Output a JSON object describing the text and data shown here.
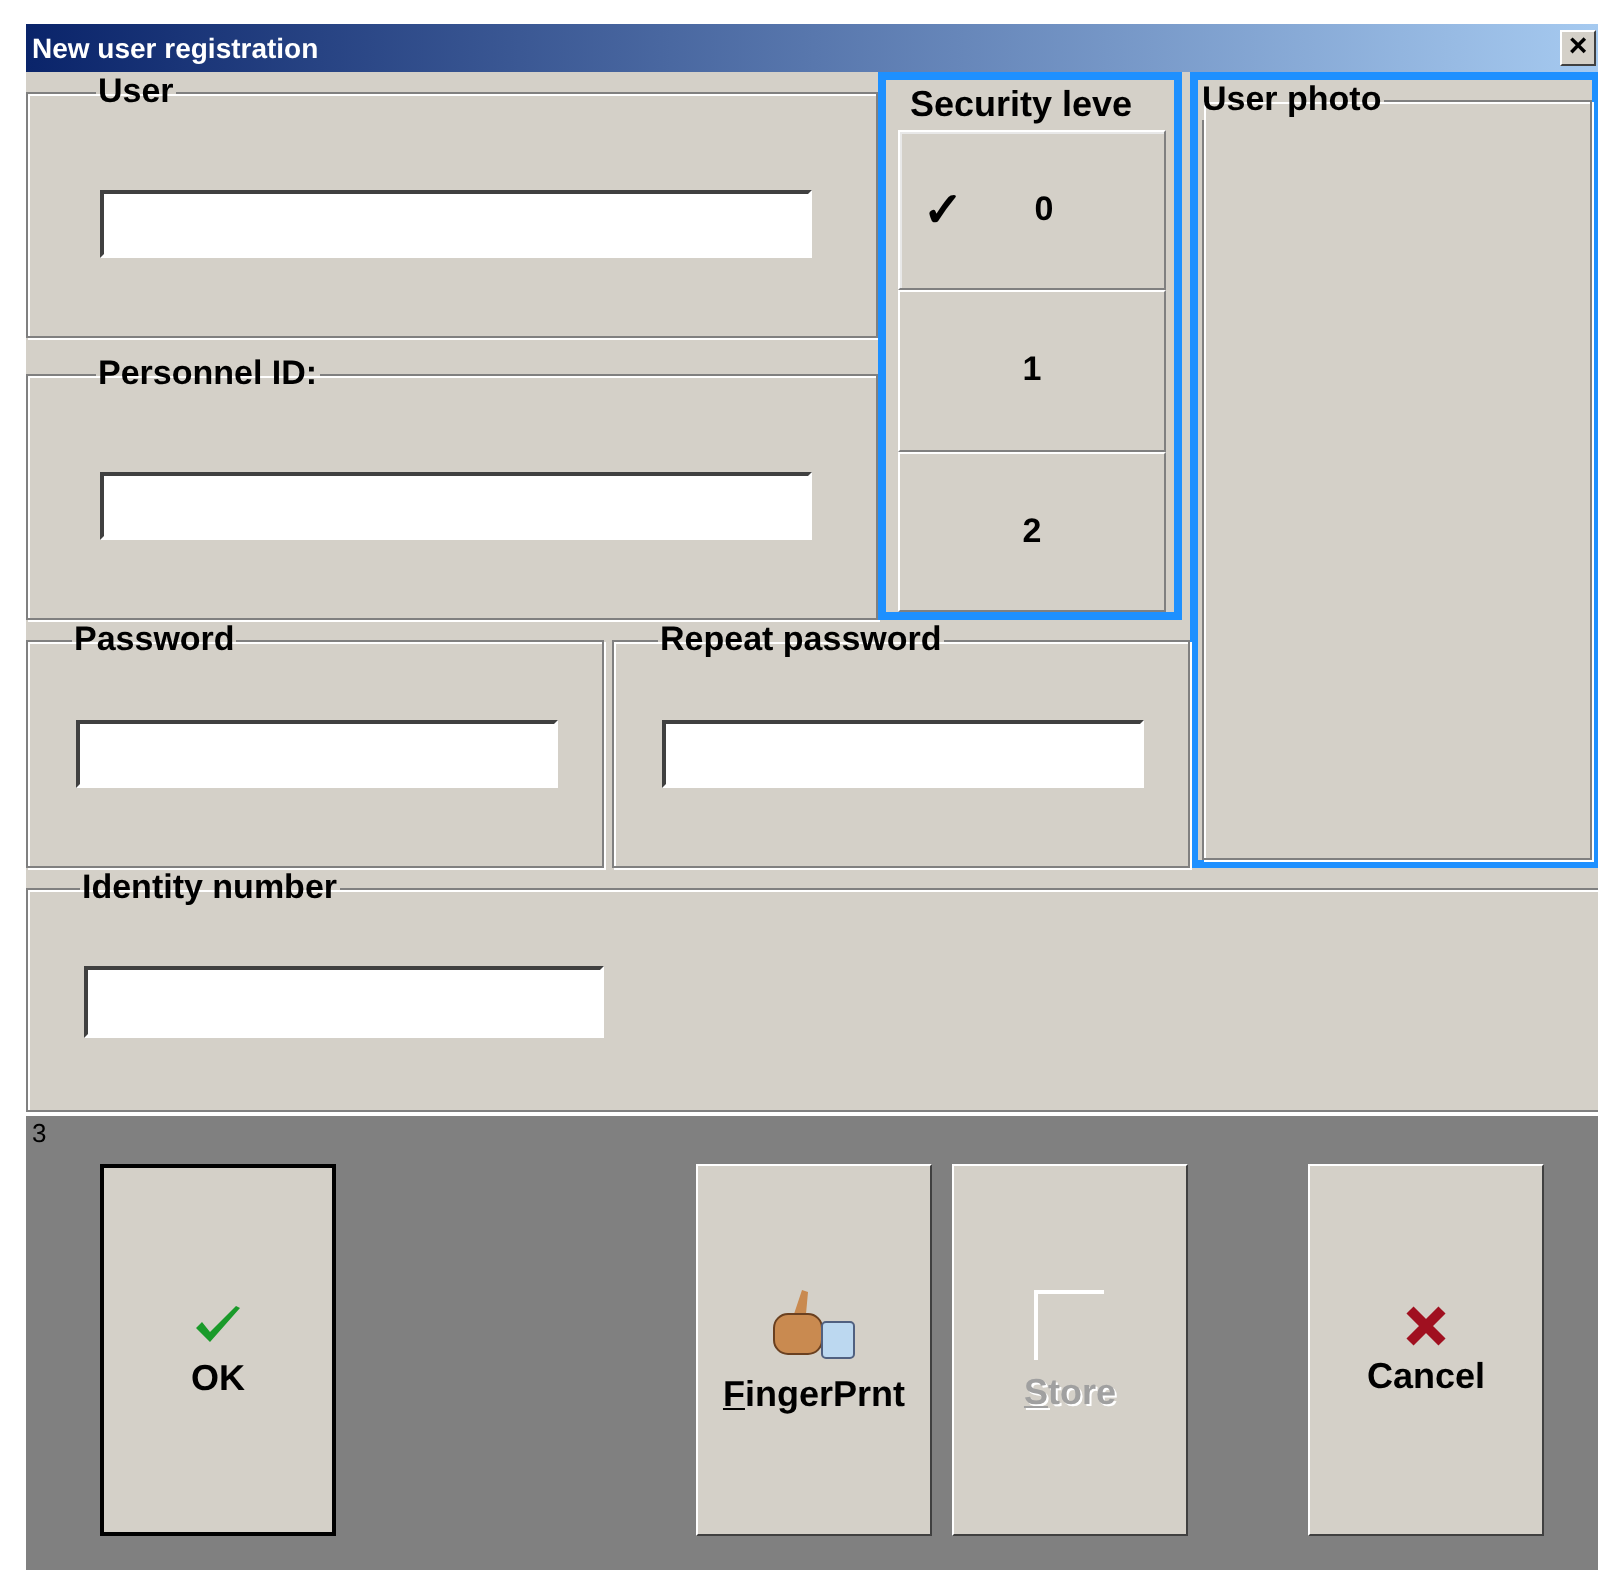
{
  "window": {
    "title": "New user registration",
    "close": "×"
  },
  "user": {
    "label": "User"
  },
  "personnel_id": {
    "label": "Personnel ID:"
  },
  "security_level": {
    "label": "Security leve",
    "mark": "✓",
    "levels": [
      {
        "label": "0",
        "selected": true
      },
      {
        "label": "1",
        "selected": false
      },
      {
        "label": "2",
        "selected": false
      }
    ]
  },
  "user_photo": {
    "label": "User photo"
  },
  "password": {
    "label": "Password"
  },
  "repeat_password": {
    "label": "Repeat password"
  },
  "identity_number": {
    "label": "Identity number"
  },
  "panel": {
    "caption": "3",
    "buttons": [
      {
        "label": "OK",
        "kind": "check",
        "default": true,
        "disabled": false,
        "access_key": false
      },
      {
        "label": "FingerPrnt",
        "kind": "thumb",
        "default": false,
        "disabled": false,
        "access_key": true
      },
      {
        "label": "Store",
        "kind": "blank",
        "default": false,
        "disabled": true,
        "access_key": true
      },
      {
        "label": "Cancel",
        "kind": "cross",
        "default": false,
        "disabled": false,
        "access_key": false
      }
    ]
  }
}
